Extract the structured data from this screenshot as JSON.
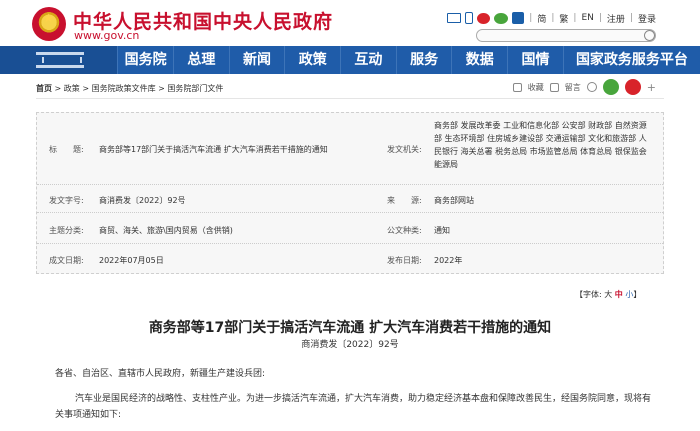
{
  "header": {
    "title": "中华人民共和国中央人民政府",
    "url": "www.gov.cn",
    "tools": [
      "简",
      "繁",
      "EN",
      "注册",
      "登录"
    ],
    "search_placeholder": ""
  },
  "nav": {
    "items": [
      "国务院",
      "总理",
      "新闻",
      "政策",
      "互动",
      "服务",
      "数据",
      "国情",
      "国家政务服务平台"
    ]
  },
  "breadcrumb": {
    "home": "首页",
    "path": " > 政策 > 国务院政策文件库 > 国务院部门文件"
  },
  "share": {
    "collect": "收藏",
    "leave_msg": "留言"
  },
  "info": {
    "title_label": "标　　题:",
    "title_value": "商务部等17部门关于搞活汽车流通 扩大汽车消费若干措施的通知",
    "issuer_label": "发文机关:",
    "issuer_value": "商务部 发展改革委 工业和信息化部 公安部 财政部 自然资源部 生态环境部 住房城乡建设部 交通运输部 文化和旅游部 人民银行 海关总署 税务总局 市场监管总局 体育总局 银保监会 能源局",
    "docno_label": "发文字号:",
    "docno_value": "商消费发〔2022〕92号",
    "source_label": "来　　源:",
    "source_value": "商务部网站",
    "category_label": "主题分类:",
    "category_value": "商贸、海关、旅游\\国内贸易（含供销)",
    "type_label": "公文种类:",
    "type_value": "通知",
    "written_label": "成文日期:",
    "written_value": "2022年07月05日",
    "published_label": "发布日期:",
    "published_value": "2022年"
  },
  "fontsize": {
    "prefix": "【字体:",
    "large": "大",
    "medium": "中",
    "small": "小",
    "suffix": "】"
  },
  "article": {
    "title": "商务部等17部门关于搞活汽车流通 扩大汽车消费若干措施的通知",
    "docno": "商消费发〔2022〕92号",
    "salutation": "各省、自治区、直辖市人民政府，新疆生产建设兵团:",
    "paragraph1": "汽车业是国民经济的战略性、支柱性产业。为进一步搞活汽车流通，扩大汽车消费，助力稳定经济基本盘和保障改善民生，经国务院同意，现将有关事项通知如下:"
  },
  "colors": {
    "brand_red": "#c8102e",
    "nav_blue": "#1f5ca9"
  }
}
